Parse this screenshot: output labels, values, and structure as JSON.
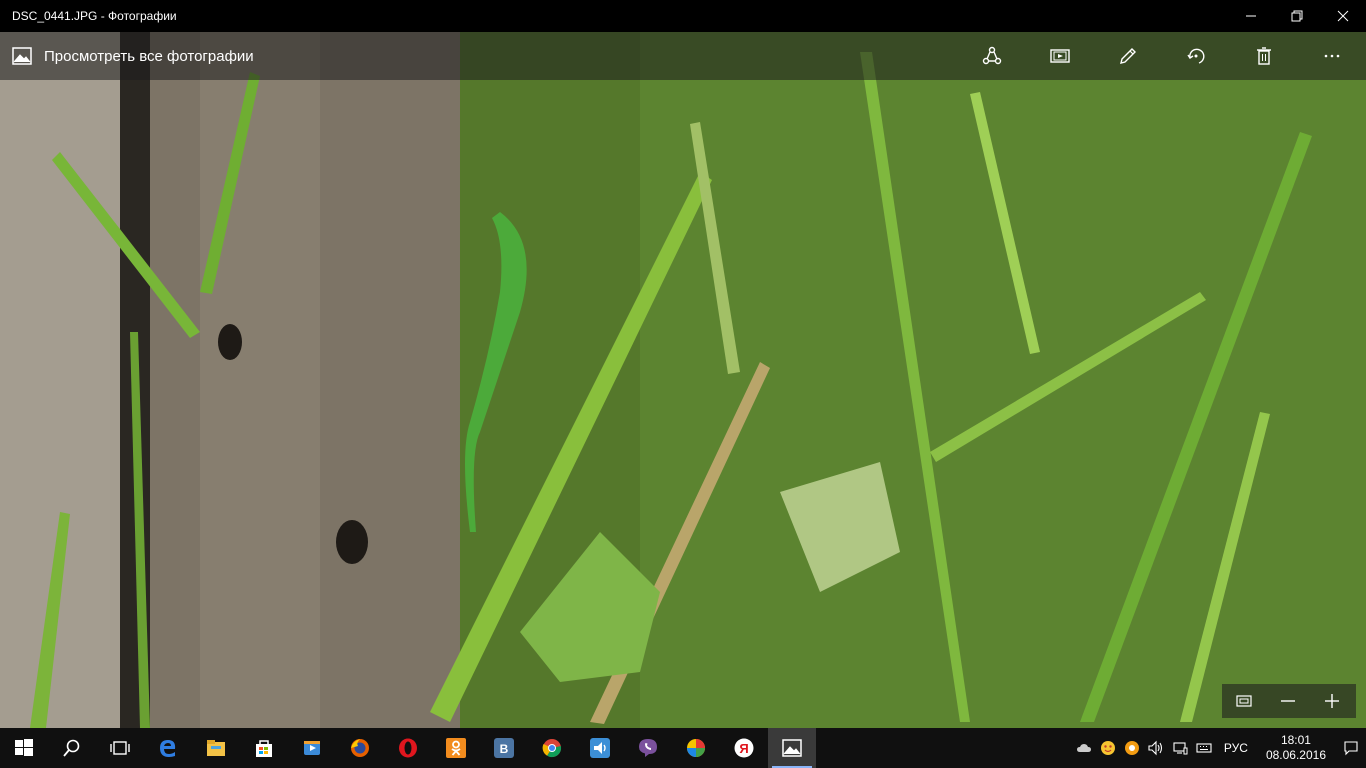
{
  "window": {
    "title": "DSC_0441.JPG - Фотографии"
  },
  "appbar": {
    "back_label": "Просмотреть все фотографии",
    "tools": [
      {
        "icon": "share-icon"
      },
      {
        "icon": "slideshow-icon"
      },
      {
        "icon": "edit-icon"
      },
      {
        "icon": "rotate-icon"
      },
      {
        "icon": "delete-icon"
      },
      {
        "icon": "more-icon"
      }
    ]
  },
  "zoom": {
    "buttons": [
      "fit-icon",
      "zoom-out-icon",
      "zoom-in-icon"
    ]
  },
  "taskbar": {
    "apps": [
      {
        "icon": "windows-start-icon"
      },
      {
        "icon": "search-icon"
      },
      {
        "icon": "task-view-icon"
      },
      {
        "icon": "edge-icon"
      },
      {
        "icon": "file-explorer-icon"
      },
      {
        "icon": "store-icon"
      },
      {
        "icon": "media-player-icon"
      },
      {
        "icon": "firefox-icon"
      },
      {
        "icon": "opera-icon"
      },
      {
        "icon": "odnoklassniki-icon"
      },
      {
        "icon": "vk-icon"
      },
      {
        "icon": "chrome-icon"
      },
      {
        "icon": "audio-app-icon"
      },
      {
        "icon": "viber-icon"
      },
      {
        "icon": "colorful-app-icon"
      },
      {
        "icon": "yandex-browser-icon"
      },
      {
        "icon": "photos-icon"
      }
    ],
    "tray": {
      "language": "РУС",
      "time": "18:01",
      "date": "08.06.2016"
    }
  },
  "colors": {
    "titlebar_bg": "#000000",
    "taskbar_bg": "#101010",
    "accent": "#8ab4f8"
  }
}
